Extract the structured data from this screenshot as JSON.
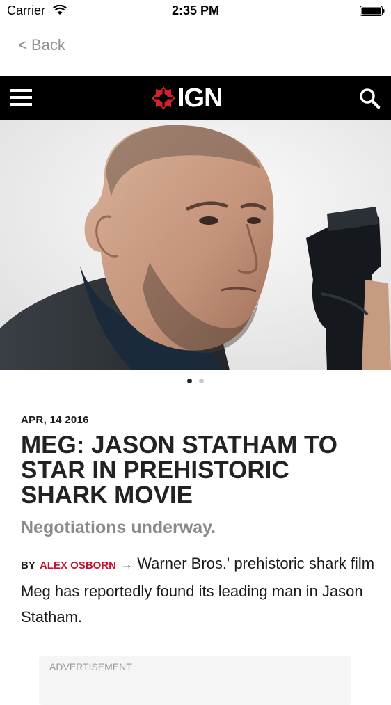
{
  "status_bar": {
    "carrier": "Carrier",
    "time": "2:35 PM"
  },
  "nav": {
    "back_label": "< Back"
  },
  "header": {
    "logo_text": "IGN",
    "brand_color": "#d2232a"
  },
  "carousel": {
    "page_count": 2,
    "active_index": 0
  },
  "article": {
    "date": "APR, 14 2016",
    "title": "MEG: JASON STATHAM TO STAR IN PREHISTORIC SHARK MOVIE",
    "subtitle": "Negotiations underway.",
    "byline_prefix": "BY",
    "author": "ALEX OSBORN",
    "arrow": "→",
    "summary": "Warner Bros.' prehistoric shark film Meg has reportedly found its leading man in Jason Statham."
  },
  "ad": {
    "label": "ADVERTISEMENT"
  }
}
